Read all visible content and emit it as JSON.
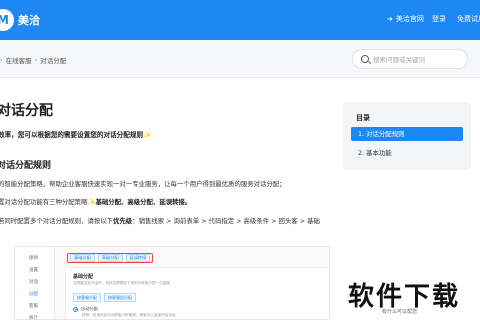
{
  "header": {
    "brand": "美洽",
    "brand_mark": "M",
    "nav": [
      {
        "label": "美洽官网",
        "arrow": "➜"
      },
      {
        "label": "登录"
      },
      {
        "label": "免费试用"
      }
    ]
  },
  "breadcrumb": {
    "sep": "›",
    "items": [
      "在线客服",
      "对话分配"
    ]
  },
  "search": {
    "placeholder": "搜索问题或关键词"
  },
  "article": {
    "title": "对话分配",
    "intro": "效率，您可以根据您的需要设置您的对话分配规则",
    "intro_emoji": "✨",
    "section_title": "对话分配规则",
    "p1": "的智能分配策略，帮助企业客服快速实现一对一专业服务，让每一个用户得到最优质的服务对话分配；",
    "p2_prefix": "置对话分配功能有三种分配策略",
    "p2_bold": "基础分配、高级分配、延误转接。",
    "p3_prefix": "若同时配置多个对话分配规则，请按以下",
    "p3_bold": "优先级",
    "p3_suffix": "：销售线索 > 询前表单 > 代码指定 > 高级条件 > 回头客 > 基础"
  },
  "screenshot": {
    "side_items": [
      "接待",
      "设置",
      "对话",
      "分配",
      "客服",
      "统计"
    ],
    "active_side": "分配",
    "tabs": [
      "基础分配",
      "高级分配",
      "延误转接"
    ],
    "card_title": "基础分配",
    "card_note": "当顾客发起对话时，系统会根据如下规则为顾客分配一位客服",
    "buttons": [
      "按客服分配",
      "按客服组分配"
    ],
    "radio_label": "自动分配",
    "radio_desc": "按照一定规则自动为顾客分配客服，顾客可以直接开始对话"
  },
  "toc": {
    "title": "目录",
    "items": [
      {
        "label": "1. 对话分配规则",
        "active": true
      },
      {
        "label": "2. 基本功能",
        "active": false
      }
    ]
  },
  "watermark": {
    "title": "软件下载",
    "sub": "有什么可以帮您"
  },
  "colors": {
    "brand_blue": "#1d87f4",
    "highlight_red": "#e7473c",
    "toc_bg": "#f4f5f7"
  }
}
